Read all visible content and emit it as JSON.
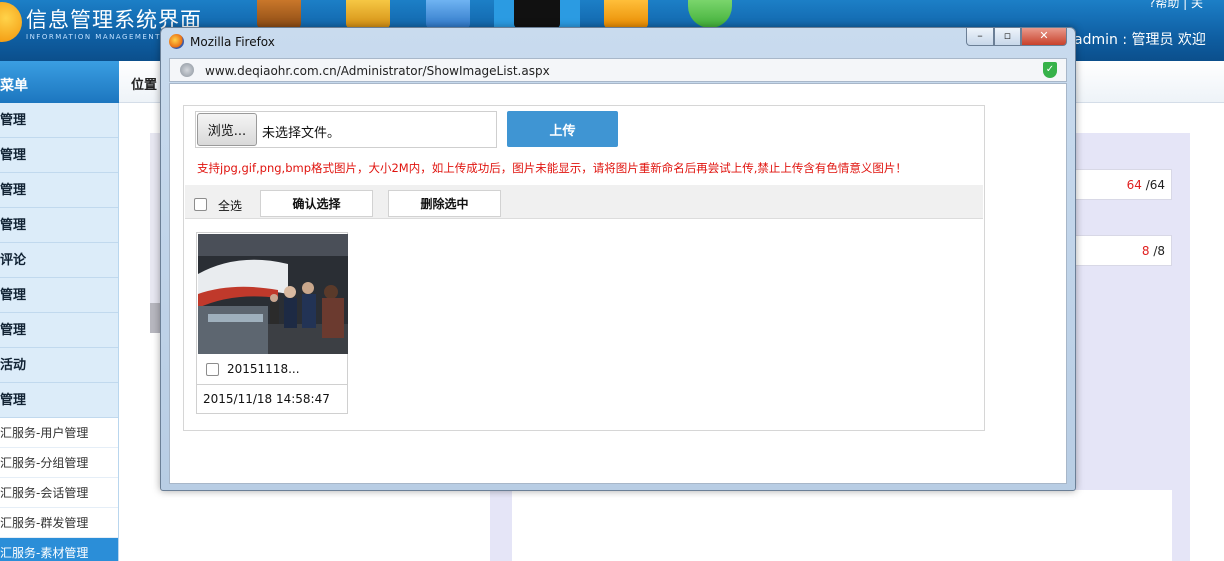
{
  "app": {
    "title": "信息管理系统界面",
    "subtitle": "INFORMATION MANAGEMENT S",
    "help_link": "?帮助 | 关",
    "user_info": "admin : 管理员  欢迎"
  },
  "sidebar": {
    "header": "菜单",
    "items": [
      "管理",
      "管理",
      "管理",
      "管理",
      "评论",
      "管理",
      "管理",
      "活动",
      "管理"
    ],
    "sub_items": [
      "汇服务-用户管理",
      "汇服务-分组管理",
      "汇服务-会话管理",
      "汇服务-群发管理",
      "汇服务-素材管理"
    ],
    "active_sub_index": 4
  },
  "breadcrumb": {
    "label": "位置"
  },
  "counters": [
    {
      "current": "64",
      "total": "/64"
    },
    {
      "current": "8",
      "total": "/8"
    }
  ],
  "popup": {
    "window_title": "Mozilla Firefox",
    "url": "www.deqiaohr.com.cn/Administrator/ShowImageList.aspx",
    "buttons": {
      "minimize": "–",
      "maximize": "▫",
      "close": "✕"
    },
    "upload": {
      "browse_label": "浏览...",
      "file_status": "未选择文件。",
      "upload_label": "上传",
      "hint": "支持jpg,gif,png,bmp格式图片，大小2M内，如上传成功后，图片未能显示，请将图片重新命名后再尝试上传,禁止上传含有色情意义图片！"
    },
    "actions": {
      "select_all": "全选",
      "confirm": "确认选择",
      "delete": "删除选中"
    },
    "images": [
      {
        "name": "20151118...",
        "date": "2015/11/18 14:58:47"
      }
    ]
  },
  "colors": {
    "accent": "#3f95d3",
    "hint_red": "#e0140f",
    "header_blue": "#0f5fa3"
  }
}
